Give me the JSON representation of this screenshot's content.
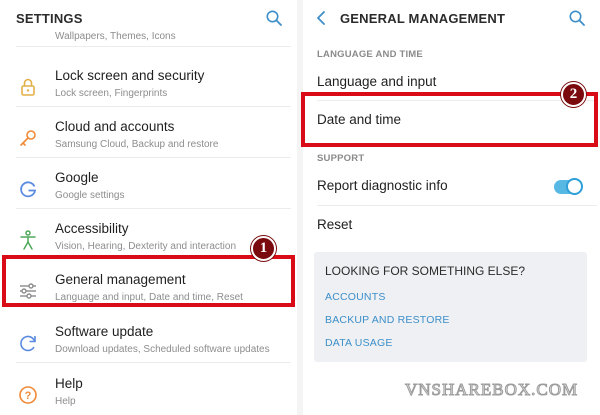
{
  "left": {
    "header": {
      "title": "SETTINGS",
      "search_icon": "search-icon"
    },
    "cut_subtitle": "Wallpapers, Themes, Icons",
    "items": [
      {
        "label": "Lock screen and security",
        "sub": "Lock screen, Fingerprints",
        "icon": "lock-icon",
        "icon_color": "#e2b04a"
      },
      {
        "label": "Cloud and accounts",
        "sub": "Samsung Cloud, Backup and restore",
        "icon": "key-icon",
        "icon_color": "#f08a37"
      },
      {
        "label": "Google",
        "sub": "Google settings",
        "icon": "google-icon",
        "icon_color": "#5b8be0"
      },
      {
        "label": "Accessibility",
        "sub": "Vision, Hearing, Dexterity and interaction",
        "icon": "accessibility-icon",
        "icon_color": "#4ea85a"
      },
      {
        "label": "General management",
        "sub": "Language and input, Date and time, Reset",
        "icon": "sliders-icon",
        "icon_color": "#8a8a8a"
      },
      {
        "label": "Software update",
        "sub": "Download updates, Scheduled software updates",
        "icon": "refresh-icon",
        "icon_color": "#5b8be0"
      },
      {
        "label": "Help",
        "sub": "Help",
        "icon": "help-icon",
        "icon_color": "#f08a37"
      }
    ]
  },
  "right": {
    "header": {
      "title": "GENERAL MANAGEMENT",
      "back_icon": "chevron-left-icon",
      "search_icon": "search-icon"
    },
    "sections": [
      {
        "title": "LANGUAGE AND TIME",
        "items": [
          "Language and input",
          "Date and time"
        ]
      },
      {
        "title": "SUPPORT",
        "items": [
          "Report diagnostic info",
          "Reset"
        ]
      }
    ],
    "toggle_on": true,
    "card": {
      "title": "LOOKING FOR SOMETHING ELSE?",
      "links": [
        "ACCOUNTS",
        "BACKUP AND RESTORE",
        "DATA USAGE"
      ]
    }
  },
  "annotations": {
    "badge_1": "1",
    "badge_2": "2",
    "highlight_color": "#d80b17"
  },
  "watermark": "VNSHAREBOX.COM",
  "colors": {
    "accent": "#3d8fc9",
    "toggle": "#57b8e4"
  }
}
